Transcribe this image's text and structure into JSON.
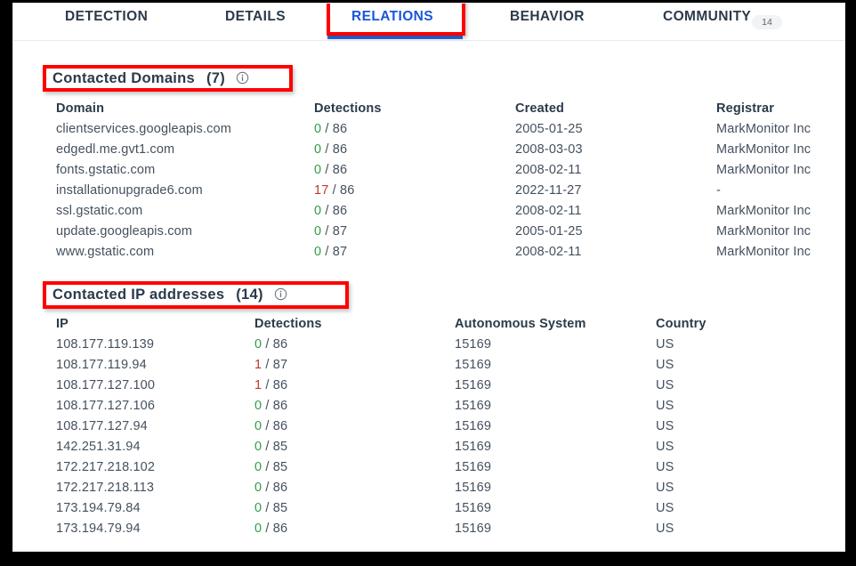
{
  "tabs": [
    {
      "label": "DETECTION",
      "active": false,
      "badge": null
    },
    {
      "label": "DETAILS",
      "active": false,
      "badge": null
    },
    {
      "label": "RELATIONS",
      "active": true,
      "badge": null
    },
    {
      "label": "BEHAVIOR",
      "active": false,
      "badge": null
    },
    {
      "label": "COMMUNITY",
      "active": false,
      "badge": "14"
    }
  ],
  "colors": {
    "accent": "#1a57d6",
    "underline": "#2c6ae4",
    "annotation": "#ff0000",
    "clean": "#2f9e44",
    "malicious": "#c0392b",
    "text": "#44505e",
    "heading": "#2b3a4a"
  },
  "domains_section": {
    "title": "Contacted Domains",
    "count": "(7)",
    "info_icon": "info-circle-icon",
    "columns": [
      "Domain",
      "Detections",
      "Created",
      "Registrar"
    ],
    "rows": [
      {
        "domain": "clientservices.googleapis.com",
        "det_count": "0",
        "det_sep": "/",
        "det_total": "86",
        "malicious": false,
        "created": "2005-01-25",
        "registrar": "MarkMonitor Inc"
      },
      {
        "domain": "edgedl.me.gvt1.com",
        "det_count": "0",
        "det_sep": "/",
        "det_total": "86",
        "malicious": false,
        "created": "2008-03-03",
        "registrar": "MarkMonitor Inc"
      },
      {
        "domain": "fonts.gstatic.com",
        "det_count": "0",
        "det_sep": "/",
        "det_total": "86",
        "malicious": false,
        "created": "2008-02-11",
        "registrar": "MarkMonitor Inc"
      },
      {
        "domain": "installationupgrade6.com",
        "det_count": "17",
        "det_sep": "/",
        "det_total": "86",
        "malicious": true,
        "created": "2022-11-27",
        "registrar": "-"
      },
      {
        "domain": "ssl.gstatic.com",
        "det_count": "0",
        "det_sep": "/",
        "det_total": "86",
        "malicious": false,
        "created": "2008-02-11",
        "registrar": "MarkMonitor Inc"
      },
      {
        "domain": "update.googleapis.com",
        "det_count": "0",
        "det_sep": "/",
        "det_total": "87",
        "malicious": false,
        "created": "2005-01-25",
        "registrar": "MarkMonitor Inc"
      },
      {
        "domain": "www.gstatic.com",
        "det_count": "0",
        "det_sep": "/",
        "det_total": "87",
        "malicious": false,
        "created": "2008-02-11",
        "registrar": "MarkMonitor Inc"
      }
    ]
  },
  "ips_section": {
    "title": "Contacted IP addresses",
    "count": "(14)",
    "info_icon": "info-circle-icon",
    "columns": [
      "IP",
      "Detections",
      "Autonomous System",
      "Country"
    ],
    "rows": [
      {
        "ip": "108.177.119.139",
        "det_count": "0",
        "det_sep": "/",
        "det_total": "86",
        "malicious": false,
        "as": "15169",
        "country": "US"
      },
      {
        "ip": "108.177.119.94",
        "det_count": "1",
        "det_sep": "/",
        "det_total": "87",
        "malicious": true,
        "as": "15169",
        "country": "US"
      },
      {
        "ip": "108.177.127.100",
        "det_count": "1",
        "det_sep": "/",
        "det_total": "86",
        "malicious": true,
        "as": "15169",
        "country": "US"
      },
      {
        "ip": "108.177.127.106",
        "det_count": "0",
        "det_sep": "/",
        "det_total": "86",
        "malicious": false,
        "as": "15169",
        "country": "US"
      },
      {
        "ip": "108.177.127.94",
        "det_count": "0",
        "det_sep": "/",
        "det_total": "86",
        "malicious": false,
        "as": "15169",
        "country": "US"
      },
      {
        "ip": "142.251.31.94",
        "det_count": "0",
        "det_sep": "/",
        "det_total": "85",
        "malicious": false,
        "as": "15169",
        "country": "US"
      },
      {
        "ip": "172.217.218.102",
        "det_count": "0",
        "det_sep": "/",
        "det_total": "85",
        "malicious": false,
        "as": "15169",
        "country": "US"
      },
      {
        "ip": "172.217.218.113",
        "det_count": "0",
        "det_sep": "/",
        "det_total": "86",
        "malicious": false,
        "as": "15169",
        "country": "US"
      },
      {
        "ip": "173.194.79.84",
        "det_count": "0",
        "det_sep": "/",
        "det_total": "85",
        "malicious": false,
        "as": "15169",
        "country": "US"
      },
      {
        "ip": "173.194.79.94",
        "det_count": "0",
        "det_sep": "/",
        "det_total": "86",
        "malicious": false,
        "as": "15169",
        "country": "US"
      }
    ]
  }
}
